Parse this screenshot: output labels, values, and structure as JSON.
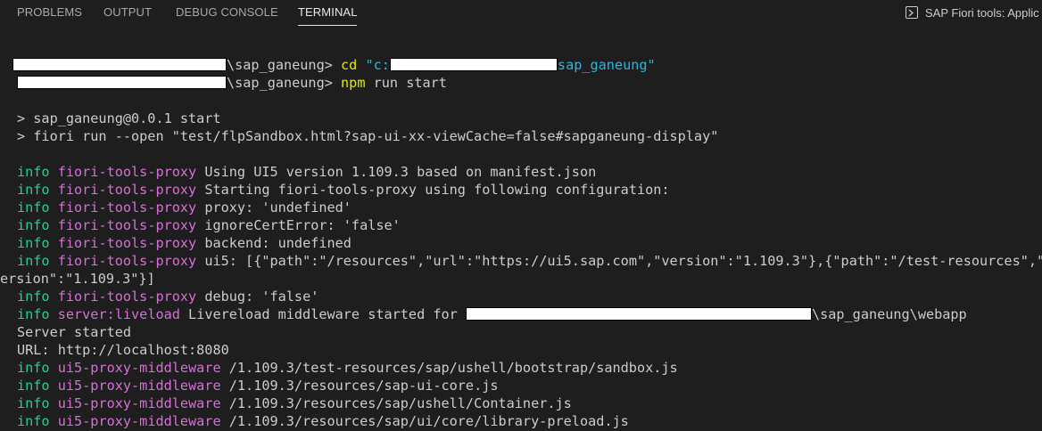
{
  "tabs": [
    {
      "label": "PROBLEMS",
      "active": false
    },
    {
      "label": "OUTPUT",
      "active": false
    },
    {
      "label": "DEBUG CONSOLE",
      "active": false
    },
    {
      "label": "TERMINAL",
      "active": true
    }
  ],
  "terminal_selector": {
    "icon": "terminal-icon",
    "label": "SAP Fiori tools: Applic"
  },
  "terminal": {
    "prompt1": {
      "dir": "\\sap_ganeung>",
      "cmd": "cd",
      "arg_prefix": "\"c:",
      "arg_suffix": "sap_ganeung\""
    },
    "prompt2": {
      "dir": "\\sap_ganeung>",
      "cmd": "npm",
      "args": "run start"
    },
    "script_line1": "> sap_ganeung@0.0.1 start",
    "script_line2": "> fiori run --open \"test/flpSandbox.html?sap-ui-xx-viewCache=false#sapganeung-display\"",
    "logs": [
      {
        "level": "info",
        "source": "fiori-tools-proxy",
        "message": "Using UI5 version 1.109.3 based on manifest.json"
      },
      {
        "level": "info",
        "source": "fiori-tools-proxy",
        "message": "Starting fiori-tools-proxy using following configuration:"
      },
      {
        "level": "info",
        "source": "fiori-tools-proxy",
        "message": "proxy: 'undefined'"
      },
      {
        "level": "info",
        "source": "fiori-tools-proxy",
        "message": "ignoreCertError: 'false'"
      },
      {
        "level": "info",
        "source": "fiori-tools-proxy",
        "message": "backend: undefined"
      },
      {
        "level": "info",
        "source": "fiori-tools-proxy",
        "message": "ui5: [{\"path\":\"/resources\",\"url\":\"https://ui5.sap.com\",\"version\":\"1.109.3\"},{\"path\":\"/test-resources\",\"url\":\"https://ui5.sap.com\",\"v"
      }
    ],
    "wrap_line": "ersion\":\"1.109.3\"}]",
    "debug_log": {
      "level": "info",
      "source": "fiori-tools-proxy",
      "message": "debug: 'false'"
    },
    "livereload_log": {
      "level": "info",
      "source": "server:liveload",
      "message": "Livereload middleware started for",
      "suffix": "\\sap_ganeung\\webapp"
    },
    "server_started": "Server started",
    "url_line": "URL: http://localhost:8080",
    "proxy_logs": [
      {
        "level": "info",
        "source": "ui5-proxy-middleware",
        "message": "/1.109.3/test-resources/sap/ushell/bootstrap/sandbox.js"
      },
      {
        "level": "info",
        "source": "ui5-proxy-middleware",
        "message": "/1.109.3/resources/sap-ui-core.js"
      },
      {
        "level": "info",
        "source": "ui5-proxy-middleware",
        "message": "/1.109.3/resources/sap/ushell/Container.js"
      },
      {
        "level": "info",
        "source": "ui5-proxy-middleware",
        "message": "/1.109.3/resources/sap/ui/core/library-preload.js"
      }
    ]
  },
  "colors": {
    "background": "#1e1e1e",
    "info": "#23d18b",
    "source": "#d670d6",
    "command": "#e5e510",
    "string": "#29b8db",
    "text": "#cccccc"
  }
}
